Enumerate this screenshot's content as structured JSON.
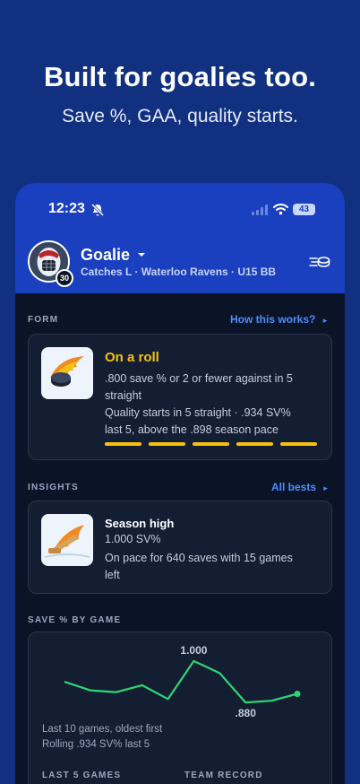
{
  "hero": {
    "title": "Built for goalies too.",
    "subtitle": "Save %, GAA, quality starts."
  },
  "status_bar": {
    "time": "12:23",
    "battery": "43"
  },
  "player": {
    "name": "Goalie",
    "number": "30",
    "meta": "Catches L · Waterloo Ravens · U15 BB"
  },
  "form": {
    "section_label": "FORM",
    "link": "How this works?",
    "title": "On a roll",
    "description_line1": ".800 save % or 2 or fewer against in 5",
    "description_line2": "straight",
    "detail_line1": "Quality starts in 5 straight · .934 SV%",
    "detail_line2": "last 5, above the .898 season pace",
    "streak_count": 5
  },
  "insights": {
    "section_label": "INSIGHTS",
    "link": "All bests",
    "title": "Season high",
    "value": "1.000 SV%",
    "pace_line1": "On pace for 640 saves with 15 games",
    "pace_line2": "left"
  },
  "chart_section": {
    "section_label": "SAVE % BY GAME",
    "note_line1": "Last 10 games, oldest first",
    "note_line2": "Rolling .934 SV% last 5"
  },
  "chart_data": {
    "type": "line",
    "x": [
      1,
      2,
      3,
      4,
      5,
      6,
      7,
      8,
      9,
      10
    ],
    "values": [
      0.94,
      0.915,
      0.91,
      0.93,
      0.89,
      1.0,
      0.965,
      0.88,
      0.885,
      0.905
    ],
    "annotations": [
      {
        "index": 5,
        "label": "1.000"
      },
      {
        "index": 7,
        "label": ".880"
      }
    ],
    "ylim": [
      0.87,
      1.01
    ],
    "color": "#2ed573"
  },
  "footer_labels": {
    "last5": "LAST 5 GAMES",
    "team_record": "TEAM RECORD"
  },
  "colors": {
    "background": "#11307f",
    "header": "#1a3fbf",
    "accent_yellow": "#f5c013",
    "link_blue": "#4d8cff",
    "line_green": "#2ed573"
  }
}
